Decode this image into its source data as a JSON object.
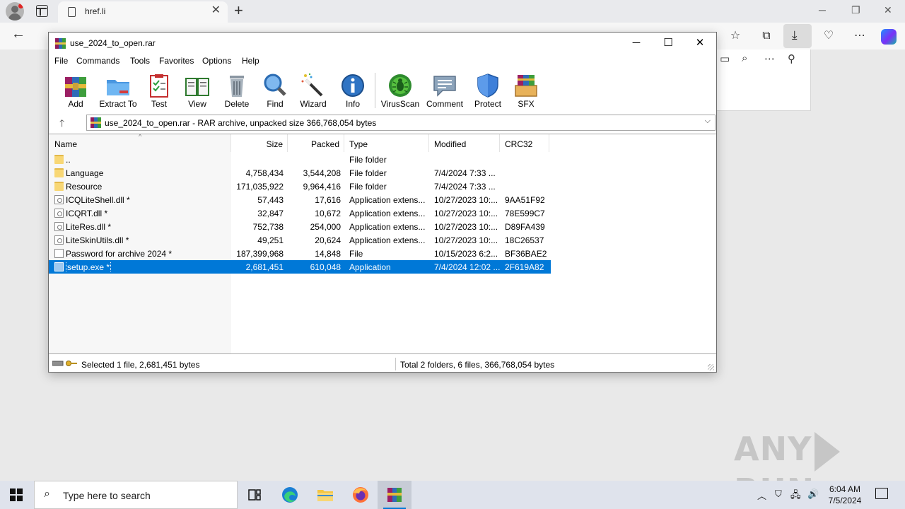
{
  "browser": {
    "tab_title": "href.li",
    "new_tab_label": "+",
    "close_tab_glyph": "✕",
    "minimize_glyph": "─",
    "restore_glyph": "❐",
    "close_glyph": "✕",
    "back_glyph": "←"
  },
  "winrar": {
    "title": "use_2024_to_open.rar",
    "menu": [
      "File",
      "Commands",
      "Tools",
      "Favorites",
      "Options",
      "Help"
    ],
    "toolbar": [
      "Add",
      "Extract To",
      "Test",
      "View",
      "Delete",
      "Find",
      "Wizard",
      "Info",
      "VirusScan",
      "Comment",
      "Protect",
      "SFX"
    ],
    "path": "use_2024_to_open.rar - RAR archive, unpacked size 366,768,054 bytes",
    "columns": [
      "Name",
      "Size",
      "Packed",
      "Type",
      "Modified",
      "CRC32"
    ],
    "rows": [
      {
        "icon": "folder",
        "name": "..",
        "size": "",
        "packed": "",
        "type": "File folder",
        "modified": "",
        "crc": ""
      },
      {
        "icon": "folder",
        "name": "Language",
        "size": "4,758,434",
        "packed": "3,544,208",
        "type": "File folder",
        "modified": "7/4/2024 7:33 ...",
        "crc": ""
      },
      {
        "icon": "folder",
        "name": "Resource",
        "size": "171,035,922",
        "packed": "9,964,416",
        "type": "File folder",
        "modified": "7/4/2024 7:33 ...",
        "crc": ""
      },
      {
        "icon": "dll",
        "name": "ICQLiteShell.dll *",
        "size": "57,443",
        "packed": "17,616",
        "type": "Application extens...",
        "modified": "10/27/2023 10:...",
        "crc": "9AA51F92"
      },
      {
        "icon": "dll",
        "name": "ICQRT.dll *",
        "size": "32,847",
        "packed": "10,672",
        "type": "Application extens...",
        "modified": "10/27/2023 10:...",
        "crc": "78E599C7"
      },
      {
        "icon": "dll",
        "name": "LiteRes.dll *",
        "size": "752,738",
        "packed": "254,000",
        "type": "Application extens...",
        "modified": "10/27/2023 10:...",
        "crc": "D89FA439"
      },
      {
        "icon": "dll",
        "name": "LiteSkinUtils.dll *",
        "size": "49,251",
        "packed": "20,624",
        "type": "Application extens...",
        "modified": "10/27/2023 10:...",
        "crc": "18C26537"
      },
      {
        "icon": "file",
        "name": "Password for archive 2024 *",
        "size": "187,399,968",
        "packed": "14,848",
        "type": "File",
        "modified": "10/15/2023 6:2...",
        "crc": "BF36BAE2"
      },
      {
        "icon": "exe",
        "name": "setup.exe *",
        "size": "2,681,451",
        "packed": "610,048",
        "type": "Application",
        "modified": "7/4/2024 12:02 ...",
        "crc": "2F619A82",
        "selected": true
      }
    ],
    "status_left": "Selected 1 file, 2,681,451 bytes",
    "status_right": "Total 2 folders, 6 files, 366,768,054 bytes"
  },
  "taskbar": {
    "search_placeholder": "Type here to search",
    "time": "6:04 AM",
    "date": "7/5/2024"
  },
  "watermark": {
    "left": "ANY",
    "right": "RUN"
  },
  "colors": {
    "selection": "#0078d7",
    "taskbar": "#dfe3ec",
    "folder": "#f8d775"
  }
}
